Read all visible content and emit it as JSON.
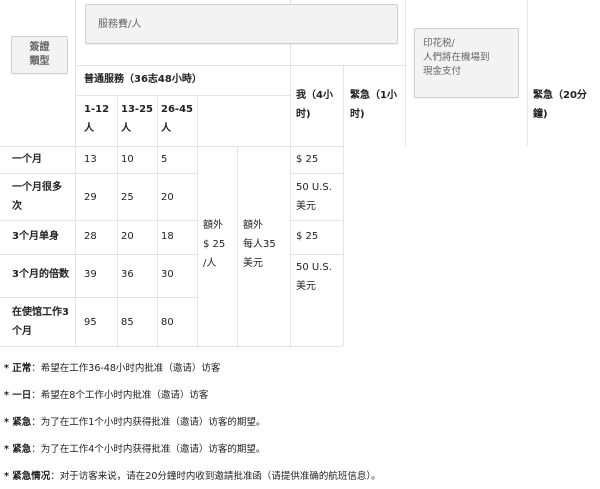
{
  "header": {
    "visa_type_button": "簽證\n類型",
    "service_fee_button": "服務費/人",
    "stamp_fee_button": "印花税/\n人們將在機場到\n現金支付",
    "normal_service": "普通服務（36志48小時）",
    "group_1": "1-12\n人",
    "group_2": "13-25\n人",
    "group_3": "26-45\n人",
    "me_4h": "我（4小\n时)",
    "urgent_1h": "緊急（1小\n时)",
    "urgent_20m": "緊急（20分\n鐘)"
  },
  "rows": [
    {
      "label": "一个月",
      "v1": "13",
      "v2": "10",
      "v3": "5",
      "stamp": "$ 25"
    },
    {
      "label": "一个月很多\n次",
      "v1": "29",
      "v2": "25",
      "v3": "20",
      "stamp": "50 U.S.\n美元"
    },
    {
      "label": "3个月单身",
      "v1": "28",
      "v2": "20",
      "v3": "18",
      "stamp": "$ 25"
    },
    {
      "label": "3个月的倍数",
      "v1": "39",
      "v2": "36",
      "v3": "30",
      "stamp": "50 U.S.\n美元"
    },
    {
      "label": "在使馆工作3\n个月",
      "v1": "95",
      "v2": "85",
      "v3": "80",
      "stamp": ""
    }
  ],
  "extra_fee_1": "額外\n$ 25\n/人",
  "extra_fee_2": "額外\n每人35\n美元",
  "notes": [
    {
      "bold": "* 正常",
      "text": "：希望在工作36-48小时内批准（邀请）访客"
    },
    {
      "bold": "* 一日",
      "text": "：希望在8个工作小时内批准（邀请）访客"
    },
    {
      "bold": " * 紧急",
      "text": "：为了在工作1个小时内获得批准（邀请）访客的期望。"
    },
    {
      "bold": "* 紧急",
      "text": "：为了在工作4个小时内获得批准（邀请）访客的期望。"
    },
    {
      "bold": "* 紧急情况",
      "text": "：对于访客来说，请在20分鐘时内收到邀請批准函（请提供准确的航班信息）。",
      "bold2": "20分鐘"
    }
  ]
}
